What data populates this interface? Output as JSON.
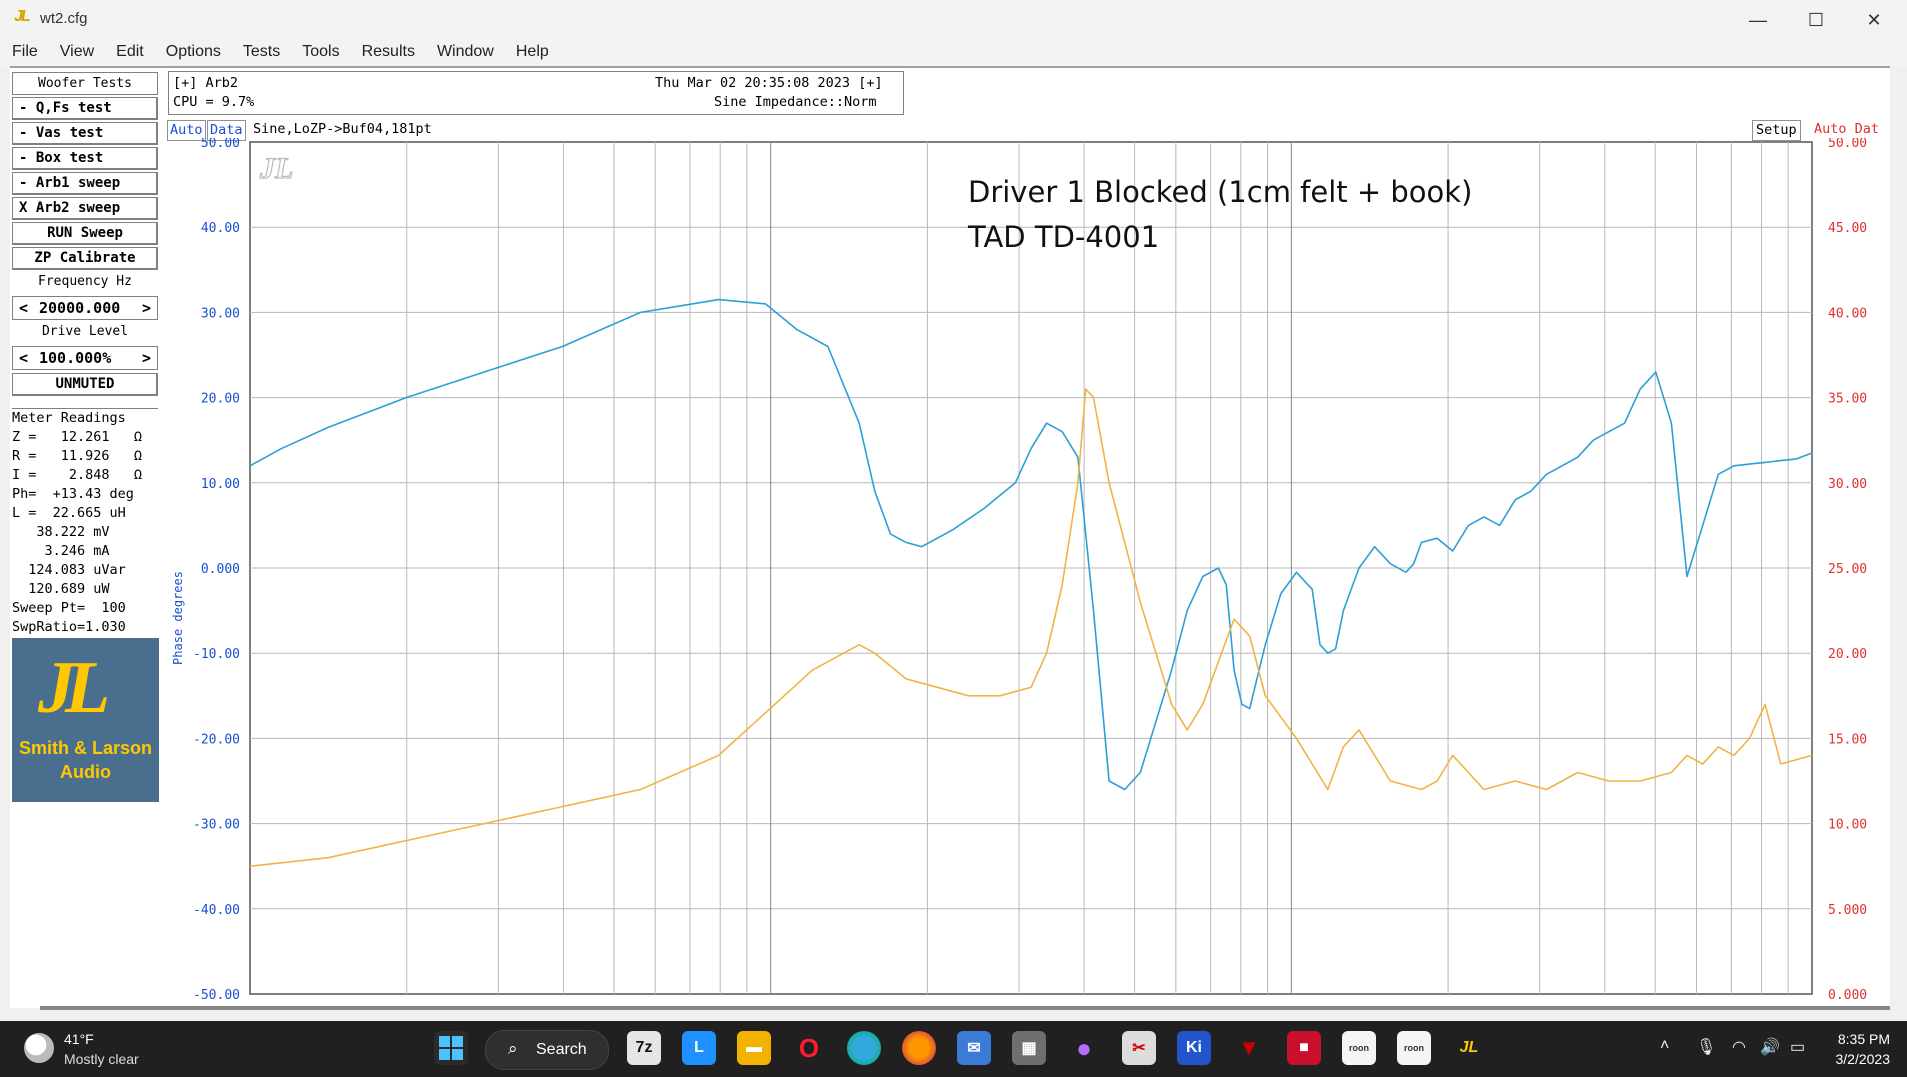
{
  "window": {
    "title": "wt2.cfg",
    "logo": "JL"
  },
  "menu": [
    "File",
    "View",
    "Edit",
    "Options",
    "Tests",
    "Tools",
    "Results",
    "Window",
    "Help"
  ],
  "left_panel": {
    "header": "Woofer Tests",
    "buttons": [
      "- Q,Fs test",
      "- Vas test",
      "- Box test",
      "- Arb1 sweep",
      "X Arb2 sweep"
    ],
    "run_sweep": "RUN Sweep",
    "zp_calibrate": "ZP Calibrate",
    "frequency_label": "Frequency Hz",
    "frequency_value": "20000.000",
    "drive_label": "Drive Level",
    "drive_value": "100.000%",
    "mute_state": "UNMUTED",
    "meter_header": "Meter Readings",
    "meter_rows": [
      "Z =   12.261   Ω",
      "R =   11.926   Ω",
      "I =    2.848   Ω",
      "Ph=  +13.43 deg",
      "L =  22.665 uH",
      "   38.222 mV",
      "    3.246 mA",
      "  124.083 uVar",
      "  120.689 uW",
      "Sweep Pt=  100",
      "SwpRatio=1.030"
    ],
    "logo_line1": "Smith & Larson",
    "logo_line2": "Audio"
  },
  "status": {
    "arb": "[+] Arb2",
    "datetime": "Thu Mar 02 20:35:08 2023 [+]",
    "cpu": "CPU = 9.7%",
    "impedance": "Sine Impedance::Norm"
  },
  "graph_header": {
    "auto": "Auto",
    "data": "Data",
    "description": "Sine,LoZP->Buf04,181pt",
    "setup": "Setup",
    "right_auto": "Auto Dat"
  },
  "annotation": {
    "line1": "Driver 1 Blocked (1cm felt + book)",
    "line2": "TAD TD-4001"
  },
  "colors": {
    "phase": "#2e9fd6",
    "impedance": "#f0b445",
    "left_axis": "#1a4fcf",
    "right_axis": "#e03030",
    "grid": "#b8b8b8"
  },
  "chart_data": {
    "type": "line",
    "left_axis": {
      "label": "Phase degrees",
      "ylim": [
        -50,
        50
      ],
      "ticks": [
        "50.00",
        "40.00",
        "30.00",
        "20.00",
        "10.00",
        "0.000",
        "-10.00",
        "-20.00",
        "-30.00",
        "-40.00",
        "-50.00"
      ]
    },
    "right_axis": {
      "ylim": [
        0,
        50
      ],
      "ticks": [
        "50.00",
        "45.00",
        "40.00",
        "35.00",
        "30.00",
        "25.00",
        "20.00",
        "15.00",
        "10.00",
        "5.000",
        "0.000"
      ]
    },
    "x_axis": {
      "scale": "log"
    },
    "grid": true,
    "series": [
      {
        "axis": "left",
        "x": [
          0,
          0.02,
          0.05,
          0.1,
          0.15,
          0.2,
          0.25,
          0.3,
          0.33,
          0.35,
          0.37,
          0.39,
          0.4,
          0.41,
          0.42,
          0.43,
          0.45,
          0.47,
          0.49,
          0.5,
          0.51,
          0.52,
          0.53,
          0.54,
          0.545,
          0.55,
          0.56,
          0.57,
          0.58,
          0.59,
          0.6,
          0.61,
          0.62,
          0.625,
          0.63,
          0.635,
          0.64,
          0.65,
          0.66,
          0.67,
          0.68,
          0.685,
          0.69,
          0.695,
          0.7,
          0.71,
          0.72,
          0.73,
          0.74,
          0.745,
          0.75,
          0.76,
          0.77,
          0.78,
          0.79,
          0.8,
          0.81,
          0.815,
          0.82,
          0.83,
          0.84,
          0.85,
          0.86,
          0.87,
          0.88,
          0.89,
          0.9,
          0.91,
          0.92,
          0.93,
          0.94,
          0.95,
          0.96,
          0.965,
          0.97,
          0.975,
          0.98,
          0.985,
          0.99,
          1
        ],
        "y": [
          12,
          14,
          16.5,
          20,
          23,
          26,
          30,
          31.5,
          31,
          28,
          26,
          17,
          9,
          4,
          3,
          2.5,
          4.5,
          7,
          10,
          14,
          17,
          16,
          13,
          -5,
          -15,
          -25,
          -26,
          -24,
          -18,
          -12,
          -5,
          -1,
          0,
          -2,
          -12,
          -16,
          -16.5,
          -9,
          -3,
          -0.5,
          -2.5,
          -9,
          -10,
          -9.5,
          -5,
          0,
          2.5,
          0.5,
          -0.5,
          0.5,
          3,
          3.5,
          2,
          5,
          6,
          5,
          8,
          8.5,
          9,
          11,
          12,
          13,
          15,
          16,
          17,
          21,
          23,
          17,
          -1,
          5,
          11,
          12,
          12.2,
          12.3,
          12.4,
          12.5,
          12.6,
          12.7,
          12.8,
          13.5
        ]
      },
      {
        "axis": "right",
        "x": [
          0,
          0.05,
          0.1,
          0.15,
          0.2,
          0.25,
          0.3,
          0.33,
          0.36,
          0.39,
          0.4,
          0.42,
          0.44,
          0.46,
          0.48,
          0.5,
          0.51,
          0.52,
          0.53,
          0.535,
          0.54,
          0.55,
          0.57,
          0.59,
          0.6,
          0.61,
          0.63,
          0.64,
          0.65,
          0.67,
          0.69,
          0.7,
          0.71,
          0.73,
          0.75,
          0.76,
          0.77,
          0.79,
          0.81,
          0.83,
          0.85,
          0.87,
          0.89,
          0.91,
          0.92,
          0.93,
          0.935,
          0.94,
          0.95,
          0.96,
          0.97,
          0.98,
          1
        ],
        "y": [
          7.5,
          8,
          9,
          10,
          11,
          12,
          14,
          16.5,
          19,
          20.5,
          20,
          18.5,
          18,
          17.5,
          17.5,
          18,
          20,
          24,
          30,
          35.5,
          35,
          30,
          23,
          17,
          15.5,
          17,
          22,
          21,
          17.5,
          15,
          12,
          14.5,
          15.5,
          12.5,
          12,
          12.5,
          14,
          12,
          12.5,
          12,
          13,
          12.5,
          12.5,
          13,
          14,
          13.5,
          14,
          14.5,
          14,
          15,
          17,
          13.5,
          14
        ]
      }
    ]
  },
  "taskbar": {
    "temp": "41°F",
    "weather": "Mostly clear",
    "search": "Search",
    "time": "8:35 PM",
    "date": "3/2/2023"
  }
}
